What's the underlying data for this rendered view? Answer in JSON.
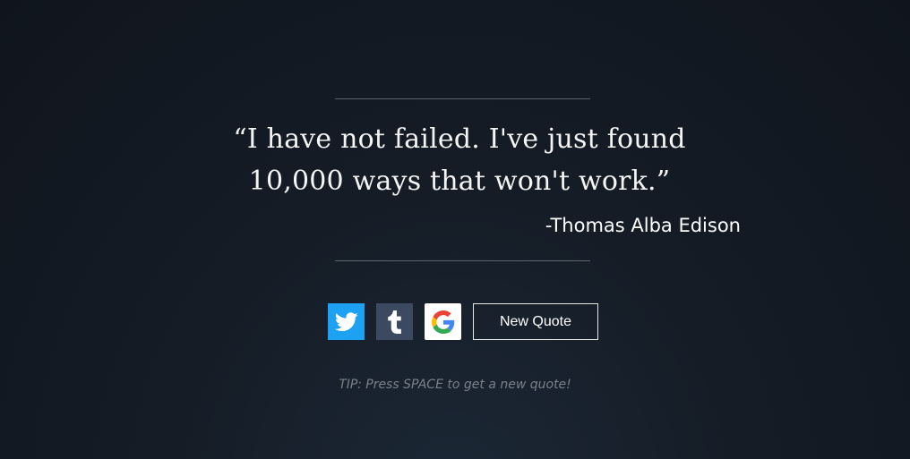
{
  "quote": {
    "text": "“I have not failed. I've just found 10,000 ways that won't work.”",
    "author": "-Thomas Alba Edison"
  },
  "actions": {
    "twitter_icon": "twitter-icon",
    "tumblr_icon": "tumblr-icon",
    "google_icon": "google-icon",
    "new_quote_label": "New Quote"
  },
  "tip": "TIP: Press SPACE to get a new quote!",
  "colors": {
    "twitter": "#1da1f2",
    "tumblr": "#3b4a60",
    "google_bg": "#ffffff",
    "background": "#151c26"
  }
}
